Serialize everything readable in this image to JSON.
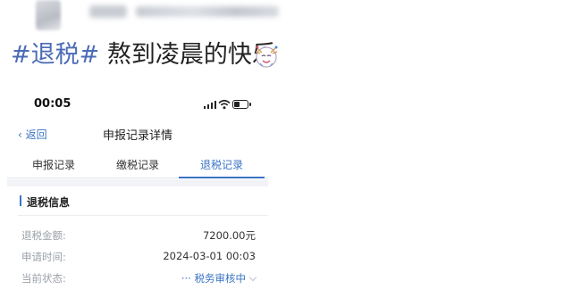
{
  "post": {
    "hashtag": "#退税#",
    "text": " 熬到凌晨的快乐",
    "emoji_icon": "celebration-face-icon"
  },
  "phone": {
    "status_time": "00:05",
    "nav": {
      "back_label": "返回",
      "title": "申报记录详情"
    },
    "tabs": [
      {
        "label": "申报记录",
        "active": false
      },
      {
        "label": "缴税记录",
        "active": false
      },
      {
        "label": "退税记录",
        "active": true
      }
    ],
    "section_title": "退税信息",
    "rows": [
      {
        "label": "退税金额:",
        "value": "7200.00元"
      },
      {
        "label": "申请时间:",
        "value": "2024-03-01 00:03"
      },
      {
        "label": "当前状态:",
        "value": "··· 税务审核中"
      }
    ],
    "accent_color": "#3a74c4"
  }
}
